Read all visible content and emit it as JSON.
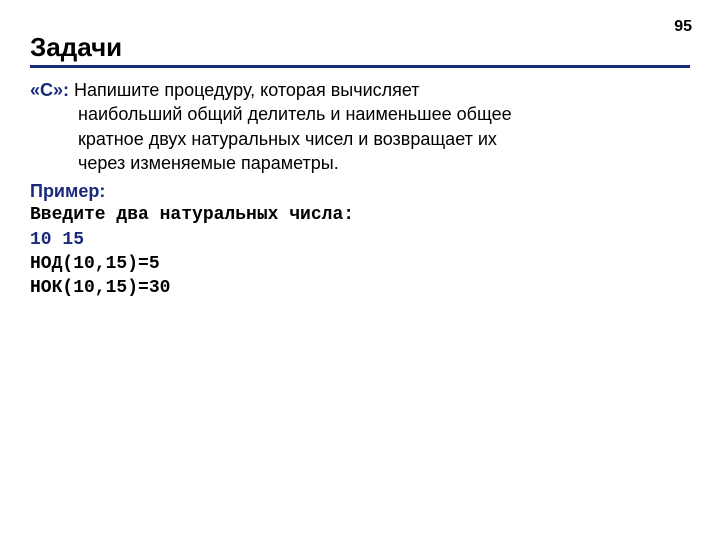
{
  "page_number": "95",
  "title": "Задачи",
  "task": {
    "label": "«C»:",
    "line1_rest": " Напишите процедуру, которая вычисляет",
    "line2": "наибольший общий делитель и наименьшее общее",
    "line3": "кратное двух натуральных чисел и возвращает их",
    "line4": "через изменяемые параметры."
  },
  "example": {
    "label": "Пример:",
    "prompt": "Введите два натуральных числа:",
    "input": "10 15",
    "output1": "НОД(10,15)=5",
    "output2": "НОК(10,15)=30"
  }
}
